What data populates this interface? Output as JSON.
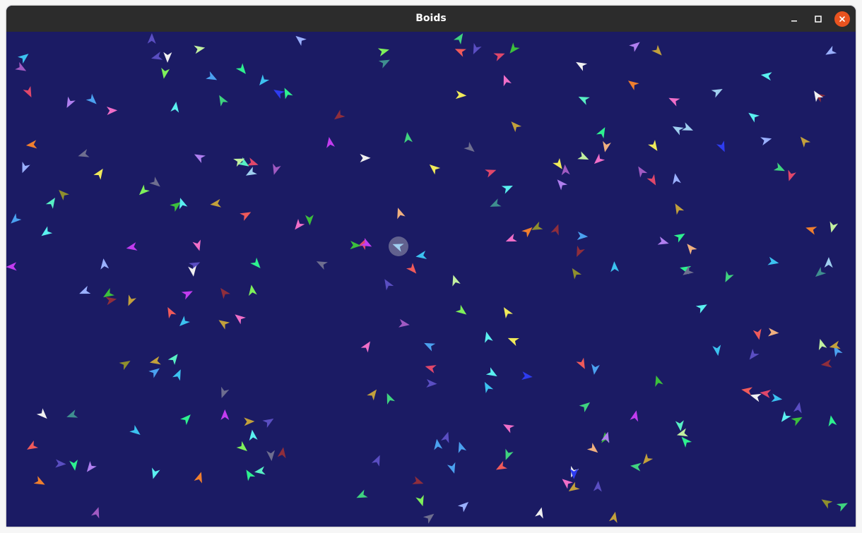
{
  "window": {
    "title": "Boids",
    "controls": {
      "minimize_icon": "minimize-icon",
      "maximize_icon": "maximize-icon",
      "close_icon": "close-icon"
    },
    "close_color": "#e9531f"
  },
  "scene": {
    "background": "#1b1b64",
    "highlight_color": "#9a9ab0",
    "boid_colors": [
      "#3fd37f",
      "#c23cf0",
      "#f0ea5a",
      "#4ba1f0",
      "#e0476a",
      "#58f0c4",
      "#a0d0f0",
      "#f07f2e",
      "#5a4ec2",
      "#3cbf3c",
      "#9ab0ff",
      "#f06ec8",
      "#3f8f8f",
      "#c2a03c",
      "#7ef05a",
      "#2e3cf0",
      "#a05ac2",
      "#f0b07f",
      "#3cc2f0",
      "#8f2e3c",
      "#c2f0a0",
      "#f0f0f0",
      "#6e6e8f",
      "#2ef08f",
      "#f05a5a",
      "#8f8f2e",
      "#5af0f0",
      "#b07ff0"
    ]
  }
}
